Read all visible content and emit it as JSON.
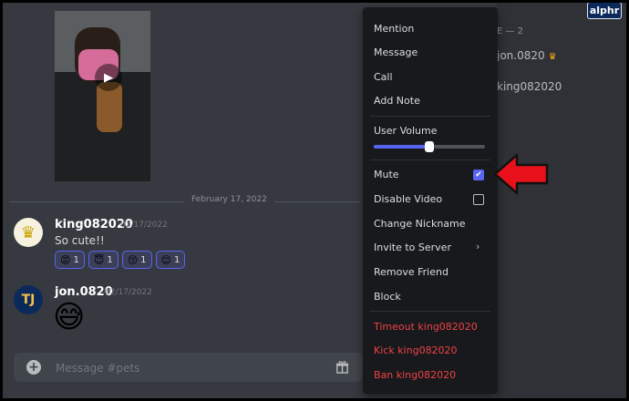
{
  "brand": "alphr",
  "members": {
    "header_fragment": "E — 2",
    "member1": "jon.0820",
    "member2": "king082020"
  },
  "chat": {
    "date_divider": "February 17, 2022",
    "messages": [
      {
        "username": "king082020",
        "timestamp": "02/17/2022",
        "text": "So cute!!",
        "reactions": [
          {
            "emoji": "😡",
            "count": "1"
          },
          {
            "emoji": "😇",
            "count": "1"
          },
          {
            "emoji": "😚",
            "count": "1"
          },
          {
            "emoji": "😊",
            "count": "1"
          }
        ]
      },
      {
        "username": "jon.0820",
        "timestamp": "02/17/2022",
        "emoji": "😅"
      }
    ],
    "avatar_jon_initials": "TJ",
    "composer_placeholder": "Message #pets"
  },
  "context_menu": {
    "items": [
      "Mention",
      "Message",
      "Call",
      "Add Note",
      "User Volume",
      "Mute",
      "Disable Video",
      "Change Nickname",
      "Invite to Server",
      "Remove Friend",
      "Block",
      "Timeout king082020",
      "Kick king082020",
      "Ban king082020"
    ],
    "user_volume_level": 0.5,
    "mute_checked": true,
    "disable_video_checked": false
  },
  "colors": {
    "accent": "#5865f2",
    "danger": "#ed4245",
    "annotation_arrow": "#e8101a"
  },
  "icons": {
    "add": "plus-circle-icon",
    "gift": "gift-icon",
    "play": "play-icon",
    "crown": "crown-icon",
    "chevron": "chevron-right-icon",
    "check": "check-icon"
  }
}
